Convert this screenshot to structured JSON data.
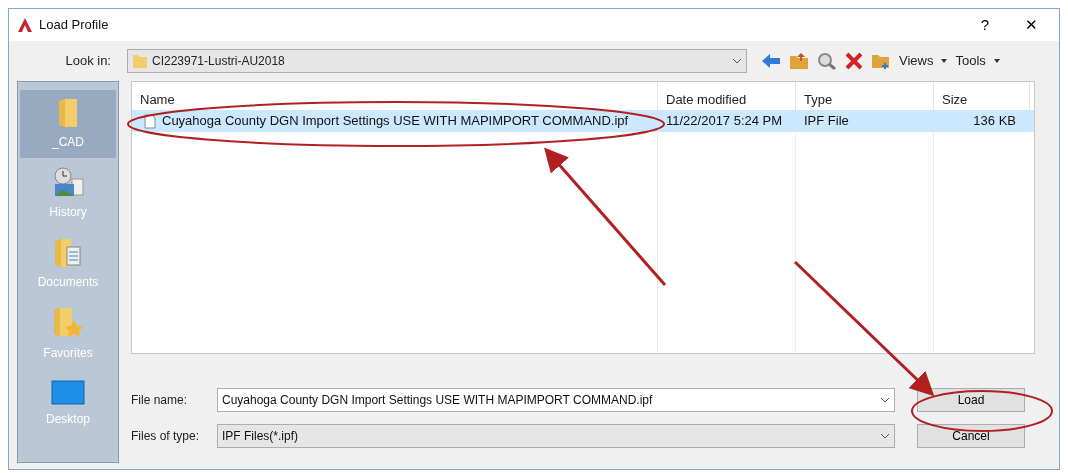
{
  "window": {
    "title": "Load Profile",
    "help": "?",
    "close": "✕"
  },
  "look_in": {
    "label": "Look in:",
    "value": "CI223971-Lustri-AU2018"
  },
  "toolbar": [
    {
      "kind": "back"
    },
    {
      "kind": "up"
    },
    {
      "kind": "search"
    },
    {
      "kind": "delete"
    },
    {
      "kind": "newfolder"
    },
    {
      "kind": "menu",
      "label": "Views"
    },
    {
      "kind": "menu",
      "label": "Tools"
    }
  ],
  "places": [
    {
      "kind": "folder",
      "label": "_CAD",
      "selected": true
    },
    {
      "kind": "history",
      "label": "History",
      "selected": false
    },
    {
      "kind": "documents",
      "label": "Documents",
      "selected": false
    },
    {
      "kind": "favorites",
      "label": "Favorites",
      "selected": false
    },
    {
      "kind": "desktop",
      "label": "Desktop",
      "selected": false
    }
  ],
  "table": {
    "columns": [
      "Name",
      "Date modified",
      "Type",
      "Size"
    ],
    "rows": [
      {
        "cells": [
          "Cuyahoga County DGN Import Settings USE WITH MAPIMPORT COMMAND.ipf",
          "11/22/2017 5:24 PM",
          "IPF File",
          "136 KB"
        ],
        "selected": true
      }
    ]
  },
  "file_name": {
    "label": "File name:",
    "value": "Cuyahoga County DGN Import Settings USE WITH MAPIMPORT COMMAND.ipf"
  },
  "file_type": {
    "label": "Files of type:",
    "value": "IPF Files(*.ipf)"
  },
  "buttons": [
    "Load",
    "Cancel"
  ]
}
